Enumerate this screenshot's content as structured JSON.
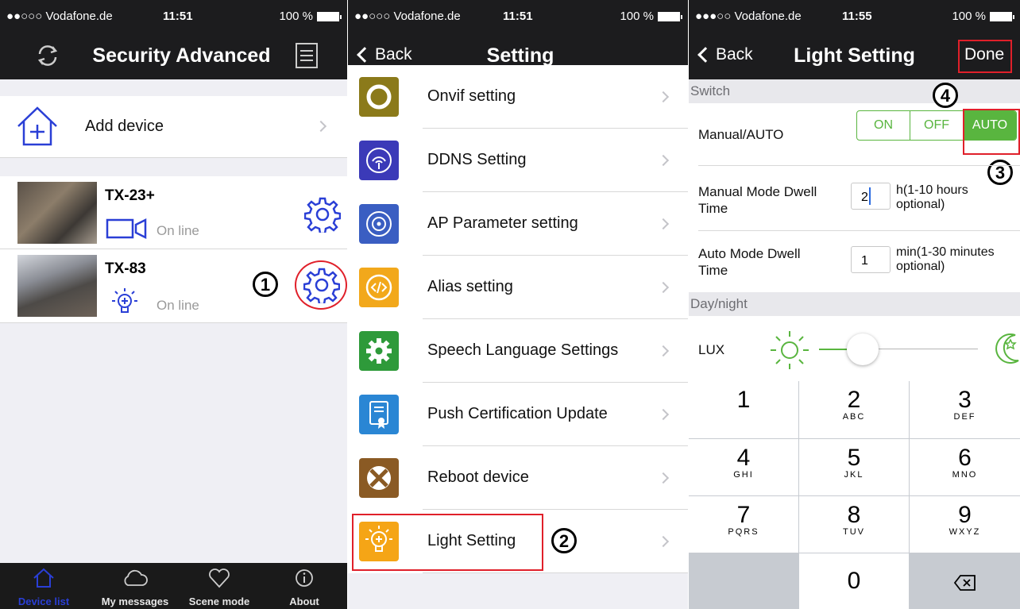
{
  "status_left": {
    "carrier": "●●○○○ Vodafone.de",
    "time": "11:51",
    "battery": "100 %"
  },
  "status_mid": {
    "carrier": "●●○○○ Vodafone.de",
    "time": "11:51",
    "battery": "100 %"
  },
  "status_right": {
    "carrier": "●●●○○ Vodafone.de",
    "time": "11:55",
    "battery": "100 %"
  },
  "device_list": {
    "title": "Security Advanced",
    "add_device": "Add device",
    "devices": [
      {
        "name": "TX-23+",
        "status": "On line"
      },
      {
        "name": "TX-83",
        "status": "On line"
      }
    ],
    "annotation": "1",
    "tabs": [
      {
        "label": "Device list",
        "icon": "home-icon"
      },
      {
        "label": "My messages",
        "icon": "cloud-icon"
      },
      {
        "label": "Scene mode",
        "icon": "heart-icon"
      },
      {
        "label": "About",
        "icon": "info-icon"
      }
    ]
  },
  "setting": {
    "back_label": "Back",
    "title": "Setting",
    "items": [
      {
        "label": "Onvif setting",
        "color": "#8b7a1a"
      },
      {
        "label": "DDNS Setting",
        "color": "#3b3ab8"
      },
      {
        "label": "AP Parameter setting",
        "color": "#3a5ec2"
      },
      {
        "label": "Alias setting",
        "color": "#f2a81b"
      },
      {
        "label": "Speech Language Settings",
        "color": "#2e9a3a"
      },
      {
        "label": "Push Certification Update",
        "color": "#2a86d4"
      },
      {
        "label": "Reboot device",
        "color": "#8a5a24"
      },
      {
        "label": "Light Setting",
        "color": "#f5a516"
      }
    ],
    "annotation": "2"
  },
  "light_setting": {
    "back_label": "Back",
    "title": "Light Setting",
    "done_label": "Done",
    "section_switch": "Switch",
    "manual_auto_label": "Manual/AUTO",
    "segments": [
      "ON",
      "OFF",
      "AUTO"
    ],
    "selected_segment": "AUTO",
    "manual_dwell_label_1": "Manual Mode Dwell",
    "manual_dwell_label_2": "Time",
    "manual_dwell_value": "2",
    "manual_dwell_unit_1": "h(1-10 hours",
    "manual_dwell_unit_2": "optional)",
    "auto_dwell_label_1": "Auto Mode Dwell",
    "auto_dwell_label_2": "Time",
    "auto_dwell_value": "1",
    "auto_dwell_unit_1": "min(1-30 minutes",
    "auto_dwell_unit_2": "optional)",
    "section_daynight": "Day/night",
    "lux_label": "LUX",
    "lux_slider_level": 0.22,
    "annotation_3": "3",
    "annotation_4": "4",
    "keypad": [
      {
        "digit": "1",
        "letters": ""
      },
      {
        "digit": "2",
        "letters": "ABC"
      },
      {
        "digit": "3",
        "letters": "DEF"
      },
      {
        "digit": "4",
        "letters": "GHI"
      },
      {
        "digit": "5",
        "letters": "JKL"
      },
      {
        "digit": "6",
        "letters": "MNO"
      },
      {
        "digit": "7",
        "letters": "PQRS"
      },
      {
        "digit": "8",
        "letters": "TUV"
      },
      {
        "digit": "9",
        "letters": "WXYZ"
      },
      {
        "digit": "0",
        "letters": ""
      }
    ],
    "accent_color": "#59b53f"
  }
}
